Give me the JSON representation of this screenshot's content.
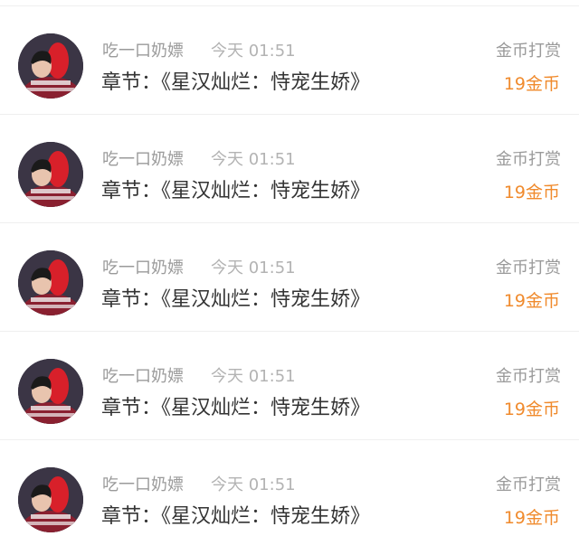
{
  "colors": {
    "accent": "#f08a2c",
    "text_primary": "#333333",
    "text_secondary": "#9a9a9a",
    "divider": "#efefef"
  },
  "items": [
    {
      "username": "吃一口奶嫖",
      "time": "今天 01:51",
      "chapter": "章节：《星汉灿烂：恃宠生娇》",
      "reward_label": "金币打赏",
      "reward_amount": "19金币",
      "avatar_icon": "user-avatar"
    },
    {
      "username": "吃一口奶嫖",
      "time": "今天 01:51",
      "chapter": "章节：《星汉灿烂：恃宠生娇》",
      "reward_label": "金币打赏",
      "reward_amount": "19金币",
      "avatar_icon": "user-avatar"
    },
    {
      "username": "吃一口奶嫖",
      "time": "今天 01:51",
      "chapter": "章节：《星汉灿烂：恃宠生娇》",
      "reward_label": "金币打赏",
      "reward_amount": "19金币",
      "avatar_icon": "user-avatar"
    },
    {
      "username": "吃一口奶嫖",
      "time": "今天 01:51",
      "chapter": "章节：《星汉灿烂：恃宠生娇》",
      "reward_label": "金币打赏",
      "reward_amount": "19金币",
      "avatar_icon": "user-avatar"
    },
    {
      "username": "吃一口奶嫖",
      "time": "今天 01:51",
      "chapter": "章节：《星汉灿烂：恃宠生娇》",
      "reward_label": "金币打赏",
      "reward_amount": "19金币",
      "avatar_icon": "user-avatar"
    }
  ]
}
